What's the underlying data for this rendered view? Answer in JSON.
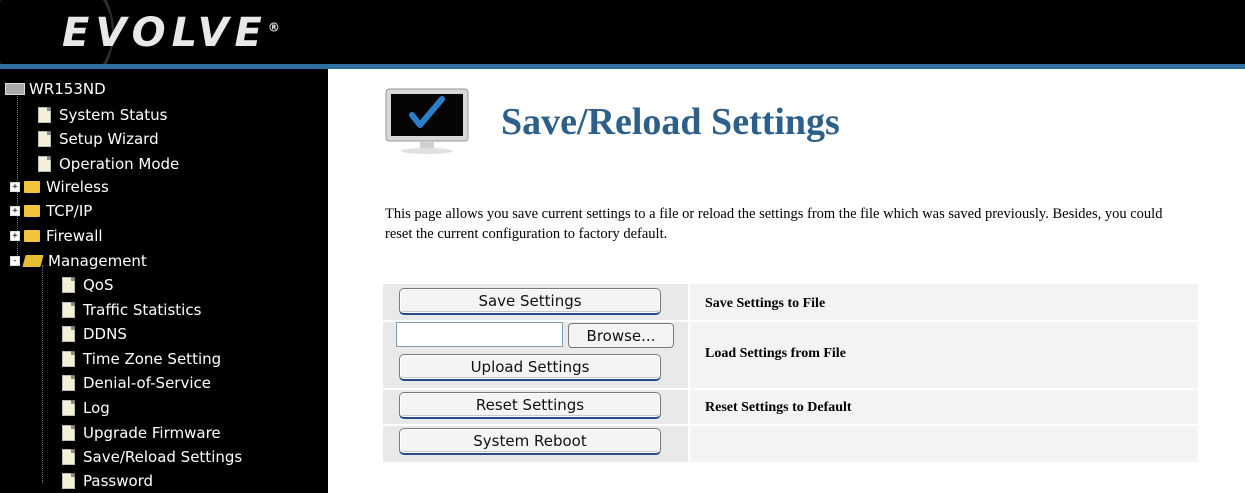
{
  "header": {
    "logo": "EVOLVE",
    "registered": "®"
  },
  "sidebar": {
    "root": "WR153ND",
    "items": [
      {
        "label": "System Status",
        "type": "page"
      },
      {
        "label": "Setup Wizard",
        "type": "page"
      },
      {
        "label": "Operation Mode",
        "type": "page"
      },
      {
        "label": "Wireless",
        "type": "folder"
      },
      {
        "label": "TCP/IP",
        "type": "folder"
      },
      {
        "label": "Firewall",
        "type": "folder"
      },
      {
        "label": "Management",
        "type": "open-folder"
      }
    ],
    "management_children": [
      "QoS",
      "Traffic Statistics",
      "DDNS",
      "Time Zone Setting",
      "Denial-of-Service",
      "Log",
      "Upgrade Firmware",
      "Save/Reload Settings",
      "Password"
    ]
  },
  "main": {
    "title": "Save/Reload Settings",
    "description": "This page allows you save current settings to a file or reload the settings from the file which was saved previously. Besides, you could reset the current configuration to factory default.",
    "save_button": "Save Settings",
    "save_label": "Save Settings to File",
    "browse_button": "Browse...",
    "file_value": "",
    "upload_button": "Upload Settings",
    "load_label": "Load Settings from File",
    "reset_button": "Reset Settings",
    "reset_label": "Reset Settings to Default",
    "reboot_button": "System Reboot"
  },
  "colors": {
    "title": "#2d5f8b",
    "header_line": "#2f6f9f",
    "check": "#2a7fc8"
  }
}
